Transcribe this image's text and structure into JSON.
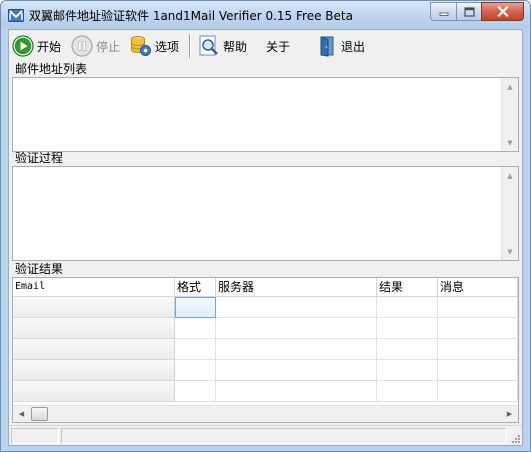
{
  "window": {
    "title": "双翼邮件地址验证软件 1and1Mail Verifier 0.15 Free Beta",
    "icon": "app-envelope-icon"
  },
  "toolbar": {
    "start": {
      "label": "开始",
      "icon": "play-icon"
    },
    "stop": {
      "label": "停止",
      "icon": "pause-icon",
      "disabled": true
    },
    "options": {
      "label": "选项",
      "icon": "database-gear-icon"
    },
    "help": {
      "label": "帮助",
      "icon": "magnifier-help-icon"
    },
    "about": {
      "label": "关于"
    },
    "exit": {
      "label": "退出",
      "icon": "exit-door-icon"
    }
  },
  "sections": {
    "email_list_label": "邮件地址列表",
    "process_label": "验证过程",
    "results_label": "验证结果"
  },
  "results_table": {
    "columns": [
      "Email",
      "格式",
      "服务器",
      "结果",
      "消息"
    ],
    "row_count": 5
  },
  "colors": {
    "title_bar": "#bcd3ee",
    "window_face": "#f0f0f0",
    "close_button": "#c44626",
    "start_green": "#2e9a2e"
  }
}
